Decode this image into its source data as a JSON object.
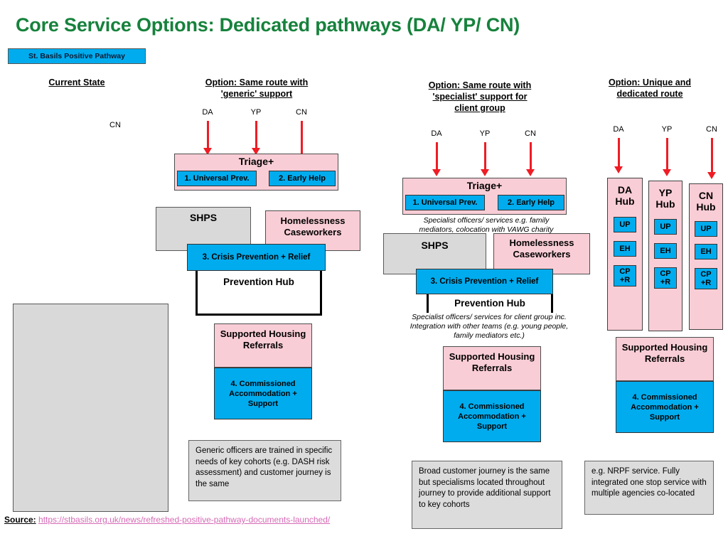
{
  "slide": {
    "title": "Core Service Options: Dedicated pathways (DA/ YP/ CN)",
    "banner": "St. Basils Positive Pathway",
    "title_color": "#16823c",
    "banner_color": "#00acee"
  },
  "palette": {
    "pink": "#f9cdd6",
    "blue": "#00acee",
    "grey": "#d9d9d9",
    "note_grey": "#dcdcdc",
    "arrow_red": "#ef1c24",
    "link_pink": "#d56ab5"
  },
  "columns": {
    "current_state": {
      "heading": "Current State",
      "cn_label": "CN"
    },
    "generic": {
      "heading_line1": "Option: Same route with",
      "heading_line2": "'generic' support",
      "inputs": [
        "DA",
        "YP",
        "CN"
      ],
      "triage": {
        "title": "Triage+",
        "stage1": "1. Universal Prev.",
        "stage2": "2. Early Help"
      },
      "shps": "SHPS",
      "caseworkers": "Homelessness Caseworkers",
      "crisis": "3. Crisis Prevention + Relief",
      "prevention_hub": "Prevention Hub",
      "supported_housing": "Supported Housing Referrals",
      "commissioned": "4. Commissioned Accommodation + Support",
      "note": "Generic officers are trained in specific needs of key cohorts (e.g. DASH risk assessment) and customer journey is the same"
    },
    "specialist": {
      "heading_line1": "Option: Same route with",
      "heading_line2": "'specialist' support for",
      "heading_line3": "client group",
      "inputs": [
        "DA",
        "YP",
        "CN"
      ],
      "triage": {
        "title": "Triage+",
        "stage1": "1. Universal Prev.",
        "stage2": "2. Early Help"
      },
      "note_triage": "Specialist officers/ services e.g. family mediators, colocation with VAWG charity",
      "shps": "SHPS",
      "caseworkers": "Homelessness Caseworkers",
      "crisis": "3. Crisis Prevention + Relief",
      "prevention_hub": "Prevention Hub",
      "note_hub": "Specialist officers/ services for client group inc. Integration with other teams (e.g. young people, family mediators etc.)",
      "supported_housing": "Supported Housing Referrals",
      "commissioned": "4. Commissioned Accommodation + Support",
      "note": "Broad customer journey is the same but specialisms located throughout journey to provide additional support to key cohorts"
    },
    "dedicated": {
      "heading_line1": "Option: Unique and",
      "heading_line2": "dedicated route",
      "inputs": [
        "DA",
        "YP",
        "CN"
      ],
      "hubs": [
        {
          "title_line1": "DA",
          "title_line2": "Hub",
          "chips": [
            "UP",
            "EH",
            "CP\n+R"
          ]
        },
        {
          "title_line1": "YP",
          "title_line2": "Hub",
          "chips": [
            "UP",
            "EH",
            "CP\n+R"
          ]
        },
        {
          "title_line1": "CN",
          "title_line2": "Hub",
          "chips": [
            "UP",
            "EH",
            "CP\n+R"
          ]
        }
      ],
      "supported_housing": "Supported Housing Referrals",
      "commissioned": "4. Commissioned Accommodation + Support",
      "note": "e.g. NRPF service. Fully integrated one stop service with multiple agencies co-located"
    }
  },
  "source": {
    "label": "Source:",
    "url": "https://stbasils.org.uk/news/refreshed-positive-pathway-documents-launched/"
  }
}
